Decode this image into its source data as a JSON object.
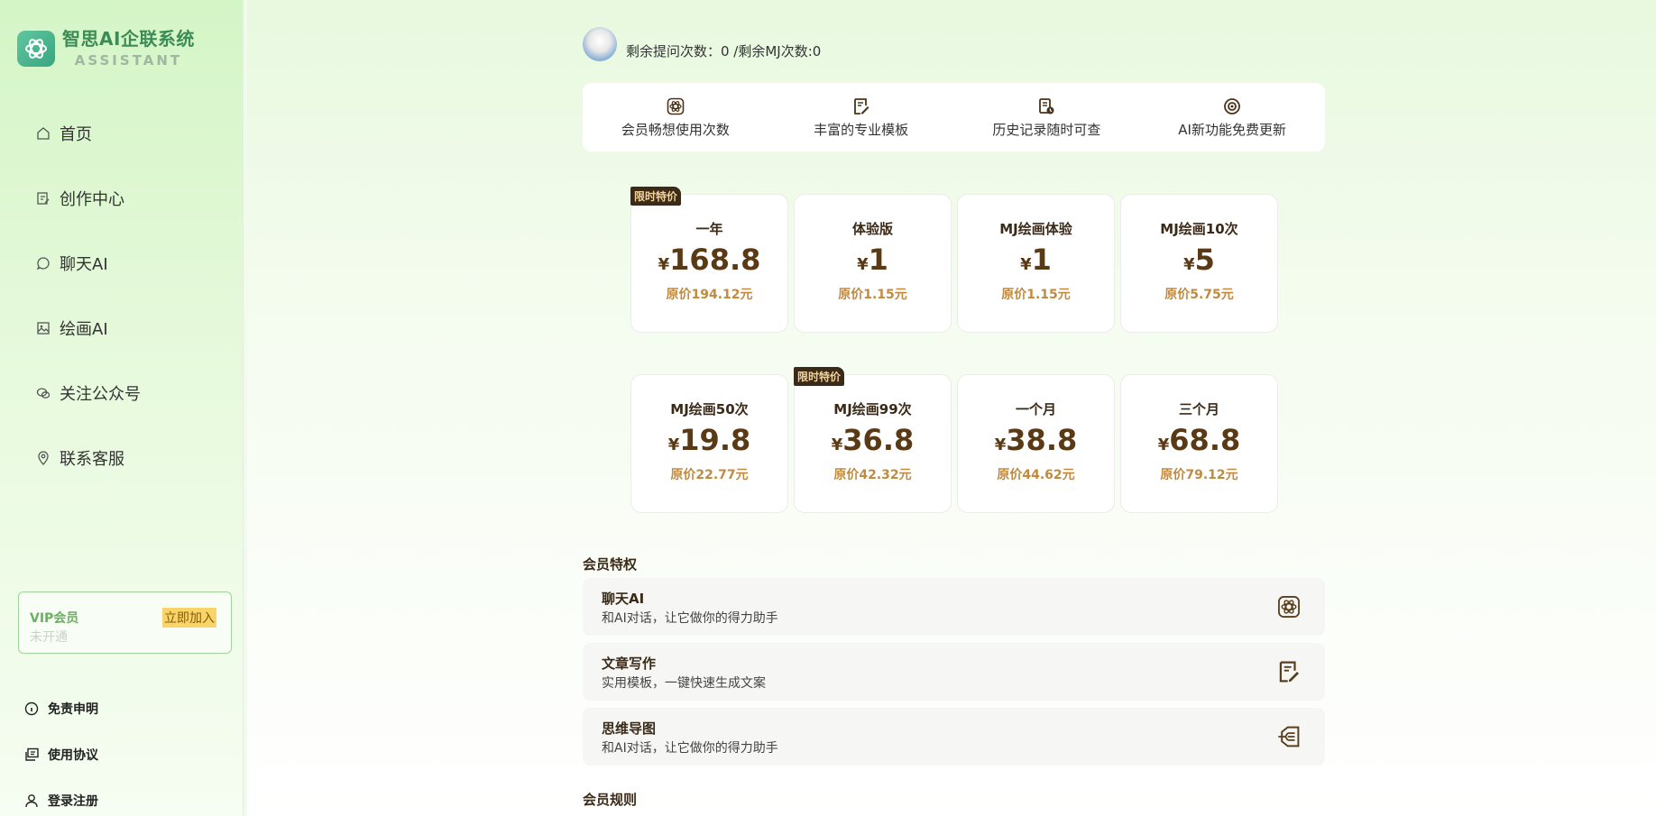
{
  "brand": {
    "title": "智思AI企联系统",
    "subtitle": "ASSISTANT"
  },
  "nav": [
    {
      "label": "首页",
      "icon": "home-icon"
    },
    {
      "label": "创作中心",
      "icon": "edit-doc-icon"
    },
    {
      "label": "聊天AI",
      "icon": "chat-bubble-icon"
    },
    {
      "label": "绘画AI",
      "icon": "image-icon"
    },
    {
      "label": "关注公众号",
      "icon": "wechat-icon"
    },
    {
      "label": "联系客服",
      "icon": "location-pin-icon"
    }
  ],
  "vip": {
    "title": "VIP会员",
    "status": "未开通",
    "join": "立即加入"
  },
  "footer": [
    {
      "label": "免责申明",
      "icon": "info-icon"
    },
    {
      "label": "使用协议",
      "icon": "agreement-icon"
    },
    {
      "label": "登录注册",
      "icon": "user-icon"
    }
  ],
  "user": {
    "quota": "剩余提问次数：0 /剩余MJ次数:0"
  },
  "features": [
    {
      "label": "会员畅想使用次数",
      "icon": "atom-icon"
    },
    {
      "label": "丰富的专业模板",
      "icon": "pen-note-icon"
    },
    {
      "label": "历史记录随时可查",
      "icon": "history-doc-icon"
    },
    {
      "label": "AI新功能免费更新",
      "icon": "target-icon"
    }
  ],
  "currency": "¥",
  "plans": [
    {
      "name": "一年",
      "price": "168.8",
      "original": "原价194.12元",
      "badge": "限时特价"
    },
    {
      "name": "体验版",
      "price": "1",
      "original": "原价1.15元",
      "badge": ""
    },
    {
      "name": "MJ绘画体验",
      "price": "1",
      "original": "原价1.15元",
      "badge": ""
    },
    {
      "name": "MJ绘画10次",
      "price": "5",
      "original": "原价5.75元",
      "badge": ""
    },
    {
      "name": "MJ绘画50次",
      "price": "19.8",
      "original": "原价22.77元",
      "badge": ""
    },
    {
      "name": "MJ绘画99次",
      "price": "36.8",
      "original": "原价42.32元",
      "badge": "限时特价"
    },
    {
      "name": "一个月",
      "price": "38.8",
      "original": "原价44.62元",
      "badge": ""
    },
    {
      "name": "三个月",
      "price": "68.8",
      "original": "原价79.12元",
      "badge": ""
    }
  ],
  "perks_title": "会员特权",
  "perks": [
    {
      "title": "聊天AI",
      "desc": "和AI对话，让它做你的得力助手",
      "icon": "atom-icon"
    },
    {
      "title": "文章写作",
      "desc": "实用模板，一键快速生成文案",
      "icon": "pen-note-icon"
    },
    {
      "title": "思维导图",
      "desc": "和AI对话，让它做你的得力助手",
      "icon": "mindmap-icon"
    }
  ],
  "rules_title": "会员规则"
}
